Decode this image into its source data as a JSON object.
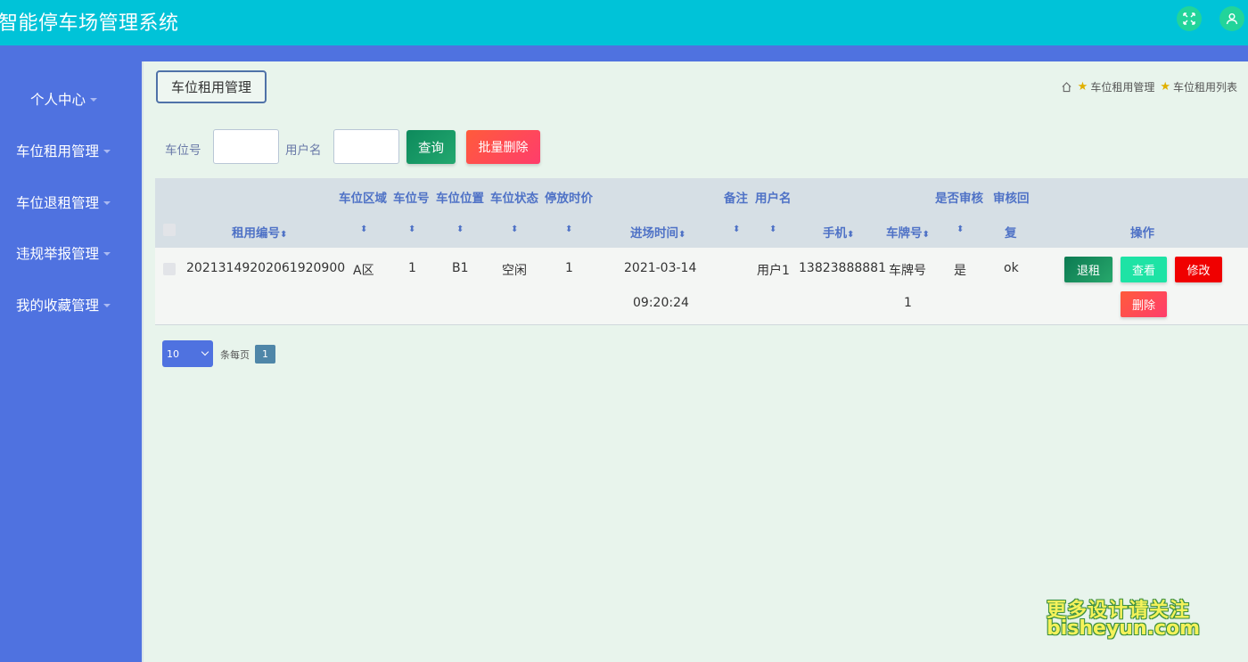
{
  "header": {
    "app_title": "智能停车场管理系统"
  },
  "sidebar": {
    "items": [
      {
        "label": "个人中心"
      },
      {
        "label": "车位租用管理"
      },
      {
        "label": "车位退租管理"
      },
      {
        "label": "违规举报管理"
      },
      {
        "label": "我的收藏管理"
      }
    ]
  },
  "page": {
    "tab_label": "车位租用管理",
    "breadcrumb": [
      "车位租用管理",
      "车位租用列表"
    ]
  },
  "search": {
    "field1_label": "车位号",
    "field1_value": "",
    "field2_label": "用户名",
    "field2_value": "",
    "query_label": "查询",
    "batch_delete_label": "批量删除"
  },
  "table": {
    "headers": {
      "rent_no": "租用编号",
      "area": "车位区域",
      "space_no": "车位号",
      "location": "车位位置",
      "status": "车位状态",
      "price": "停放时价",
      "entry_time": "进场时间",
      "remark": "备注",
      "username": "用户名",
      "phone": "手机",
      "plate": "车牌号",
      "audited": "是否审核",
      "reply_a": "审核回",
      "reply_b": "复",
      "actions": "操作"
    },
    "sort_glyph": "⬍",
    "rows": [
      {
        "rent_no": "20213149202061920900",
        "area": "A区",
        "space_no": "1",
        "location": "B1",
        "status": "空闲",
        "price": "1",
        "entry_date": "2021-03-14",
        "entry_clock": "09:20:24",
        "remark": "",
        "username": "用户1",
        "phone": "13823888881",
        "plate_a": "车牌号",
        "plate_b": "1",
        "audited": "是",
        "reply": "ok",
        "actions": {
          "checkout": "退租",
          "view": "查看",
          "edit": "修改",
          "delete": "删除"
        }
      }
    ]
  },
  "pagination": {
    "page_size": "10",
    "per_page_label": "条每页",
    "current_page": "1"
  },
  "watermark": {
    "line1": "更多设计请关注",
    "line2": "bisheyun.com"
  },
  "colors": {
    "header_bg": "#00c3d8",
    "sidebar_bg": "#4f72e0",
    "content_bg": "#e8f4ec",
    "query_btn": "#0d8a5c",
    "delete_btn": "#ff3d6c",
    "view_btn": "#1ee3a5",
    "edit_btn": "#f00000"
  }
}
